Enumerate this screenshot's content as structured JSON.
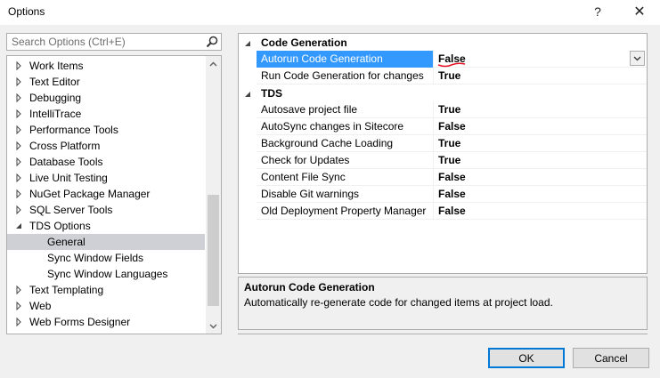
{
  "window": {
    "title": "Options",
    "help_glyph": "?",
    "close_glyph": "✕"
  },
  "search": {
    "placeholder": "Search Options (Ctrl+E)",
    "value": ""
  },
  "tree": {
    "items": [
      {
        "label": "Work Items",
        "level": 0,
        "expander": "collapsed",
        "selected": false
      },
      {
        "label": "Text Editor",
        "level": 0,
        "expander": "collapsed",
        "selected": false
      },
      {
        "label": "Debugging",
        "level": 0,
        "expander": "collapsed",
        "selected": false
      },
      {
        "label": "IntelliTrace",
        "level": 0,
        "expander": "collapsed",
        "selected": false
      },
      {
        "label": "Performance Tools",
        "level": 0,
        "expander": "collapsed",
        "selected": false
      },
      {
        "label": "Cross Platform",
        "level": 0,
        "expander": "collapsed",
        "selected": false
      },
      {
        "label": "Database Tools",
        "level": 0,
        "expander": "collapsed",
        "selected": false
      },
      {
        "label": "Live Unit Testing",
        "level": 0,
        "expander": "collapsed",
        "selected": false
      },
      {
        "label": "NuGet Package Manager",
        "level": 0,
        "expander": "collapsed",
        "selected": false
      },
      {
        "label": "SQL Server Tools",
        "level": 0,
        "expander": "collapsed",
        "selected": false
      },
      {
        "label": "TDS Options",
        "level": 0,
        "expander": "expanded",
        "selected": false
      },
      {
        "label": "General",
        "level": 1,
        "expander": "none",
        "selected": true
      },
      {
        "label": "Sync Window Fields",
        "level": 1,
        "expander": "none",
        "selected": false
      },
      {
        "label": "Sync Window Languages",
        "level": 1,
        "expander": "none",
        "selected": false
      },
      {
        "label": "Text Templating",
        "level": 0,
        "expander": "collapsed",
        "selected": false
      },
      {
        "label": "Web",
        "level": 0,
        "expander": "collapsed",
        "selected": false
      },
      {
        "label": "Web Forms Designer",
        "level": 0,
        "expander": "collapsed",
        "selected": false
      }
    ],
    "scroll": {
      "thumb_start": 0.5,
      "thumb_end": 0.95
    }
  },
  "property_grid": {
    "categories": [
      {
        "name": "Code Generation",
        "properties": [
          {
            "name": "Autorun Code Generation",
            "value": "False",
            "selected": true
          },
          {
            "name": "Run Code Generation for changes",
            "value": "True",
            "selected": false
          }
        ]
      },
      {
        "name": "TDS",
        "properties": [
          {
            "name": "Autosave project file",
            "value": "True",
            "selected": false
          },
          {
            "name": "AutoSync changes in Sitecore",
            "value": "False",
            "selected": false
          },
          {
            "name": "Background Cache Loading",
            "value": "True",
            "selected": false
          },
          {
            "name": "Check for Updates",
            "value": "True",
            "selected": false
          },
          {
            "name": "Content File Sync",
            "value": "False",
            "selected": false
          },
          {
            "name": "Disable Git warnings",
            "value": "False",
            "selected": false
          },
          {
            "name": "Old Deployment Property Manager",
            "value": "False",
            "selected": false
          }
        ]
      }
    ]
  },
  "description": {
    "title": "Autorun Code Generation",
    "text": "Automatically re-generate code for changed items at project load."
  },
  "buttons": {
    "ok": "OK",
    "cancel": "Cancel"
  },
  "colors": {
    "selection": "#3399ff",
    "tree_selection": "#cfcfd6",
    "annotation": "#e81123",
    "ok_border": "#0078d7"
  }
}
